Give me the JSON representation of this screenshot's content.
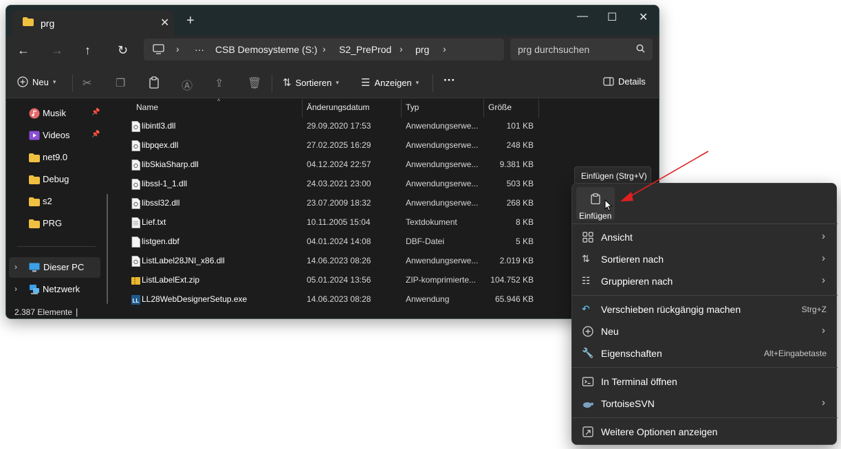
{
  "window": {
    "tab_title": "prg",
    "new_tab": "+",
    "controls": {
      "minimize": "—",
      "maximize": "☐",
      "close": "✕"
    }
  },
  "nav": {
    "back": "←",
    "forward": "→",
    "up": "↑",
    "refresh": "↻",
    "breadcrumb": [
      "CSB Demosysteme (S:)",
      "S2_PreProd",
      "prg"
    ],
    "more": "···",
    "search_placeholder": "prg durchsuchen"
  },
  "toolbar": {
    "new_label": "Neu",
    "sort_label": "Sortieren",
    "view_label": "Anzeigen",
    "more_label": "···",
    "details_label": "Details"
  },
  "sidebar": {
    "items": [
      {
        "label": "Musik",
        "icon": "music-icon",
        "pinned": true
      },
      {
        "label": "Videos",
        "icon": "video-icon",
        "pinned": true
      },
      {
        "label": "net9.0",
        "icon": "folder-icon"
      },
      {
        "label": "Debug",
        "icon": "folder-icon"
      },
      {
        "label": "s2",
        "icon": "folder-icon"
      },
      {
        "label": "PRG",
        "icon": "folder-icon"
      }
    ],
    "locations": [
      {
        "label": "Dieser PC",
        "icon": "pc-icon",
        "selected": true
      },
      {
        "label": "Netzwerk",
        "icon": "network-icon"
      }
    ]
  },
  "columns": {
    "name": "Name",
    "date": "Änderungsdatum",
    "type": "Typ",
    "size": "Größe"
  },
  "files": [
    {
      "name": "libintl3.dll",
      "date": "29.09.2020 17:53",
      "type": "Anwendungserwe...",
      "size": "101 KB",
      "icon": "dll-icon"
    },
    {
      "name": "libpqex.dll",
      "date": "27.02.2025 16:29",
      "type": "Anwendungserwe...",
      "size": "248 KB",
      "icon": "dll-icon"
    },
    {
      "name": "libSkiaSharp.dll",
      "date": "04.12.2024 22:57",
      "type": "Anwendungserwe...",
      "size": "9.381 KB",
      "icon": "dll-icon"
    },
    {
      "name": "libssl-1_1.dll",
      "date": "24.03.2021 23:00",
      "type": "Anwendungserwe...",
      "size": "503 KB",
      "icon": "dll-icon"
    },
    {
      "name": "libssl32.dll",
      "date": "23.07.2009 18:32",
      "type": "Anwendungserwe...",
      "size": "268 KB",
      "icon": "dll-icon"
    },
    {
      "name": "Lief.txt",
      "date": "10.11.2005 15:04",
      "type": "Textdokument",
      "size": "8 KB",
      "icon": "txt-icon"
    },
    {
      "name": "listgen.dbf",
      "date": "04.01.2024 14:08",
      "type": "DBF-Datei",
      "size": "5 KB",
      "icon": "file-icon"
    },
    {
      "name": "ListLabel28JNI_x86.dll",
      "date": "14.06.2023 08:26",
      "type": "Anwendungserwe...",
      "size": "2.019 KB",
      "icon": "dll-icon"
    },
    {
      "name": "ListLabelExt.zip",
      "date": "05.01.2024 13:56",
      "type": "ZIP-komprimierte...",
      "size": "104.752 KB",
      "icon": "zip-icon"
    },
    {
      "name": "LL28WebDesignerSetup.exe",
      "date": "14.06.2023 08:28",
      "type": "Anwendung",
      "size": "65.946 KB",
      "icon": "exe-icon"
    }
  ],
  "status": {
    "count": "2.387 Elemente",
    "cursor": "|"
  },
  "tooltip": "Einfügen (Strg+V)",
  "context_menu": {
    "paste_label": "Einfügen",
    "items": [
      {
        "label": "Ansicht",
        "icon": "grid-icon",
        "submenu": true
      },
      {
        "label": "Sortieren nach",
        "icon": "sort-icon",
        "submenu": true
      },
      {
        "label": "Gruppieren nach",
        "icon": "group-icon",
        "submenu": true
      },
      {
        "label": "Verschieben rückgängig machen",
        "icon": "undo-icon",
        "shortcut": "Strg+Z"
      },
      {
        "label": "Neu",
        "icon": "plus-circle-icon",
        "submenu": true
      },
      {
        "label": "Eigenschaften",
        "icon": "wrench-icon",
        "shortcut": "Alt+Eingabetaste"
      },
      {
        "label": "In Terminal öffnen",
        "icon": "terminal-icon"
      },
      {
        "label": "TortoiseSVN",
        "icon": "tortoise-icon",
        "submenu": true
      },
      {
        "label": "Weitere Optionen anzeigen",
        "icon": "more-options-icon"
      }
    ]
  },
  "colors": {
    "accent": "#60cdff",
    "folder": "#f0c040",
    "arrow": "#e02020"
  }
}
